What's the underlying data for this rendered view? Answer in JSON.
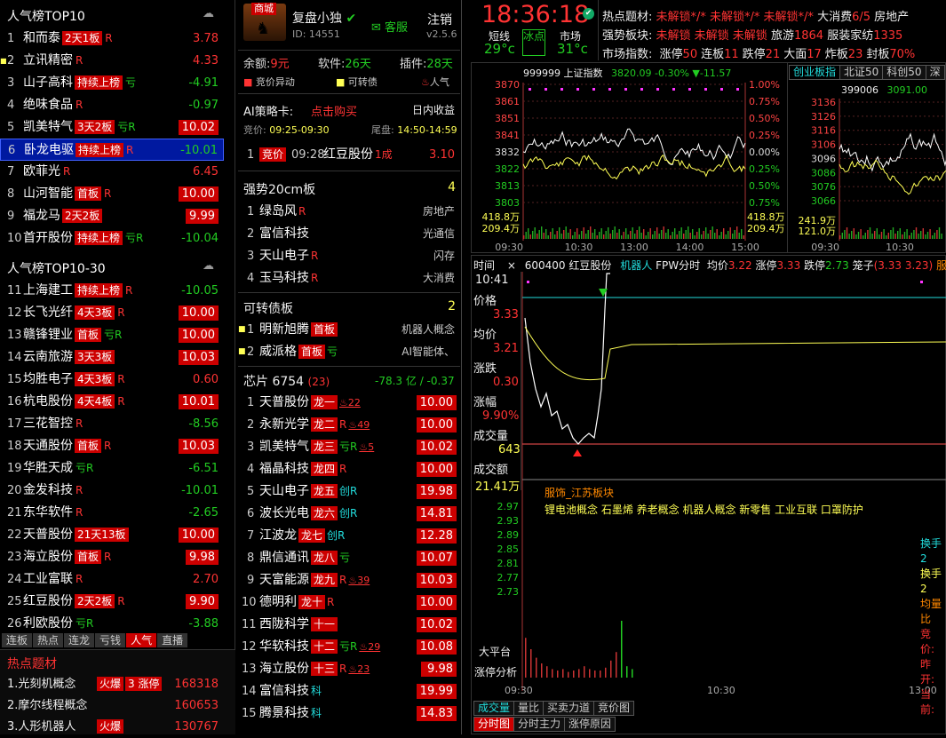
{
  "left": {
    "top10_title": "人气榜TOP10",
    "top10": [
      {
        "rank": "1",
        "name": "和而泰",
        "tag": "2天1板",
        "r": "R",
        "value": "3.78",
        "vc": "red"
      },
      {
        "rank": "2",
        "name": "立讯精密",
        "tag": "",
        "r": "R",
        "value": "4.33",
        "vc": "red",
        "mark": true
      },
      {
        "rank": "3",
        "name": "山子高科",
        "tag": "持续上榜",
        "r": "亏",
        "value": "-4.91",
        "vc": "grn"
      },
      {
        "rank": "4",
        "name": "绝味食品",
        "tag": "",
        "r": "R",
        "value": "-0.97",
        "vc": "grn"
      },
      {
        "rank": "5",
        "name": "凯美特气",
        "tag": "3天2板",
        "r": "亏R",
        "value": "10.02",
        "vc": "box"
      },
      {
        "rank": "6",
        "name": "卧龙电驱",
        "tag": "持续上榜",
        "r": "R",
        "value": "-10.01",
        "vc": "grn",
        "sel": true
      },
      {
        "rank": "7",
        "name": "欧菲光",
        "tag": "",
        "r": "R",
        "value": "6.45",
        "vc": "red"
      },
      {
        "rank": "8",
        "name": "山河智能",
        "tag": "首板",
        "r": "R",
        "value": "10.00",
        "vc": "box"
      },
      {
        "rank": "9",
        "name": "福龙马",
        "tag": "2天2板",
        "r": "",
        "value": "9.99",
        "vc": "box"
      },
      {
        "rank": "10",
        "name": "首开股份",
        "tag": "持续上榜",
        "r": "亏R",
        "value": "-10.04",
        "vc": "grn"
      }
    ],
    "top30_title": "人气榜TOP10-30",
    "top30": [
      {
        "rank": "11",
        "name": "上海建工",
        "tag": "持续上榜",
        "r": "R",
        "value": "-10.05",
        "vc": "grn"
      },
      {
        "rank": "12",
        "name": "长飞光纤",
        "tag": "4天3板",
        "r": "R",
        "value": "10.00",
        "vc": "box"
      },
      {
        "rank": "13",
        "name": "赣锋锂业",
        "tag": "首板",
        "r": "亏R",
        "value": "10.00",
        "vc": "box"
      },
      {
        "rank": "14",
        "name": "云南旅游",
        "tag": "3天3板",
        "r": "",
        "value": "10.03",
        "vc": "box"
      },
      {
        "rank": "15",
        "name": "均胜电子",
        "tag": "4天3板",
        "r": "R",
        "value": "0.60",
        "vc": "red"
      },
      {
        "rank": "16",
        "name": "杭电股份",
        "tag": "4天4板",
        "r": "R",
        "value": "10.01",
        "vc": "box"
      },
      {
        "rank": "17",
        "name": "三花智控",
        "tag": "",
        "r": "R",
        "value": "-8.56",
        "vc": "grn"
      },
      {
        "rank": "18",
        "name": "天通股份",
        "tag": "首板",
        "r": "R",
        "value": "10.03",
        "vc": "box"
      },
      {
        "rank": "19",
        "name": "华胜天成",
        "tag": "",
        "r": "亏R",
        "value": "-6.51",
        "vc": "grn"
      },
      {
        "rank": "20",
        "name": "金发科技",
        "tag": "",
        "r": "R",
        "value": "-10.01",
        "vc": "grn"
      },
      {
        "rank": "21",
        "name": "东华软件",
        "tag": "",
        "r": "R",
        "value": "-2.65",
        "vc": "grn"
      },
      {
        "rank": "22",
        "name": "天普股份",
        "tag": "21天13板",
        "r": "",
        "value": "10.00",
        "vc": "box"
      },
      {
        "rank": "23",
        "name": "海立股份",
        "tag": "首板",
        "r": "R",
        "value": "9.98",
        "vc": "box"
      },
      {
        "rank": "24",
        "name": "工业富联",
        "tag": "",
        "r": "R",
        "value": "2.70",
        "vc": "red"
      },
      {
        "rank": "25",
        "name": "红豆股份",
        "tag": "2天2板",
        "r": "R",
        "value": "9.90",
        "vc": "box"
      },
      {
        "rank": "26",
        "name": "利欧股份",
        "tag": "",
        "r": "亏R",
        "value": "-3.88",
        "vc": "grn"
      }
    ],
    "tabs": [
      "连板",
      "热点",
      "连龙",
      "亏钱",
      "人气",
      "直播"
    ],
    "active_tab": "人气",
    "hot_title": "热点题材",
    "hot": [
      {
        "name": "1.光刻机概念",
        "tags": [
          "火爆",
          "3 涨停"
        ],
        "value": "168318"
      },
      {
        "name": "2.摩尔线程概念",
        "tags": [],
        "value": "160653"
      },
      {
        "name": "3.人形机器人",
        "tags": [
          "火爆"
        ],
        "value": "130767"
      }
    ]
  },
  "mid": {
    "badge": "商城",
    "user": "复盘小独",
    "user_id": "ID: 14551",
    "service": "客服",
    "logout": "注销",
    "version": "v2.5.6",
    "balance": "余额:",
    "balance_val": "9元",
    "software": "软件:",
    "software_val": "26天",
    "plugin": "插件:",
    "plugin_val": "28天",
    "legend": [
      "竞价异动",
      "可转债",
      "人气"
    ],
    "ai_title": "AI策略卡:",
    "ai_buy": "点击购买",
    "ai_right": "日内收益",
    "auction_lbl": "竞价:",
    "auction_time": "09:25-09:30",
    "tail_lbl": "尾盘:",
    "tail_time": "14:50-14:59",
    "ai_row": {
      "rank": "1",
      "tag": "竞价",
      "time": "09:28",
      "name": "红豆股份",
      "board": "1成",
      "value": "3.10"
    },
    "s20_title": "强势20cm板",
    "s20_count": "4",
    "s20": [
      {
        "rank": "1",
        "name": "绿岛风",
        "r": "R",
        "sector": "房地产"
      },
      {
        "rank": "2",
        "name": "富信科技",
        "r": "",
        "sector": "光通信"
      },
      {
        "rank": "3",
        "name": "天山电子",
        "r": "R",
        "sector": "闪存"
      },
      {
        "rank": "4",
        "name": "玉马科技",
        "r": "R",
        "sector": "大消费"
      }
    ],
    "cb_title": "可转债板",
    "cb_count": "2",
    "cb": [
      {
        "rank": "1",
        "name": "明新旭腾",
        "tag": "首板",
        "r": "",
        "sector": "机器人概念"
      },
      {
        "rank": "2",
        "name": "威派格",
        "tag": "首板",
        "r": "亏",
        "sector": "AI智能体、"
      }
    ],
    "chip_title": "芯片",
    "chip_count": "6754",
    "chip_sub": "(23)",
    "chip_amt": "-78.3 亿",
    "chip_pct": "-0.37",
    "chips": [
      {
        "rank": "1",
        "name": "天普股份",
        "tag": "龙一",
        "r": "",
        "heat": "♨22",
        "value": "10.00"
      },
      {
        "rank": "2",
        "name": "永新光学",
        "tag": "龙二",
        "r": "R",
        "heat": "♨49",
        "value": "10.00"
      },
      {
        "rank": "3",
        "name": "凯美特气",
        "tag": "龙三",
        "r": "亏R",
        "heat": "♨5",
        "value": "10.02"
      },
      {
        "rank": "4",
        "name": "福晶科技",
        "tag": "龙四",
        "r": "R",
        "heat": "",
        "value": "10.00"
      },
      {
        "rank": "5",
        "name": "天山电子",
        "tag": "龙五",
        "r": "创R",
        "heat": "",
        "value": "19.98"
      },
      {
        "rank": "6",
        "name": "波长光电",
        "tag": "龙六",
        "r": "创R",
        "heat": "",
        "value": "14.81"
      },
      {
        "rank": "7",
        "name": "江波龙",
        "tag": "龙七",
        "r": "创R",
        "heat": "",
        "value": "12.28"
      },
      {
        "rank": "8",
        "name": "鼎信通讯",
        "tag": "龙八",
        "r": "亏",
        "heat": "",
        "value": "10.07"
      },
      {
        "rank": "9",
        "name": "天富能源",
        "tag": "龙九",
        "r": "R",
        "heat": "♨39",
        "value": "10.03"
      },
      {
        "rank": "10",
        "name": "德明利",
        "tag": "龙十",
        "r": "R",
        "heat": "",
        "value": "10.00"
      },
      {
        "rank": "11",
        "name": "西陇科学",
        "tag": "十一",
        "r": "",
        "heat": "",
        "value": "10.02"
      },
      {
        "rank": "12",
        "name": "华软科技",
        "tag": "十二",
        "r": "亏R",
        "heat": "♨29",
        "value": "10.08"
      },
      {
        "rank": "13",
        "name": "海立股份",
        "tag": "十三",
        "r": "R",
        "heat": "♨23",
        "value": "9.98"
      },
      {
        "rank": "14",
        "name": "富信科技",
        "tag": "",
        "r": "科",
        "heat": "",
        "value": "19.99"
      },
      {
        "rank": "15",
        "name": "腾景科技",
        "tag": "",
        "r": "科",
        "heat": "",
        "value": "14.83"
      }
    ]
  },
  "top": {
    "clock": "18:36:18",
    "short": "短线",
    "short_val": "29°c",
    "ice": "冰点",
    "market": "市场",
    "market_val": "31°c",
    "hot_label": "热点题材:",
    "hot_items": "未解锁*/* 未解锁*/* 未解锁*/*",
    "hot_tail": "大消费",
    "hot_tail_v": "6/5",
    "hot_tail2": "房地产",
    "strong_label": "强势板块:",
    "strong_items": "未解锁 未解锁 未解锁",
    "strong_tail": "旅游",
    "strong_tail_v": "1864",
    "strong_tail2": "服装家纺",
    "strong_tail2_v": "1335",
    "idx_label": "市场指数:",
    "idx": [
      {
        "k": "涨停",
        "v": "50"
      },
      {
        "k": "连板",
        "v": "11"
      },
      {
        "k": "跌停",
        "v": "21"
      },
      {
        "k": "大面",
        "v": "17"
      },
      {
        "k": "炸板",
        "v": "23"
      },
      {
        "k": "封板",
        "v": "70%"
      }
    ]
  },
  "index_chart": {
    "code": "999999",
    "name": "上证指数",
    "price": "3820.09",
    "pct": "-0.30%",
    "chg": "▼-11.57",
    "yticks": [
      "3870",
      "3861",
      "3851",
      "3841",
      "3832",
      "3822",
      "3813",
      "3803"
    ],
    "pticks": [
      "1.00%",
      "0.75%",
      "0.50%",
      "0.25%",
      "0.00%",
      "0.25%",
      "0.50%",
      "0.75%"
    ],
    "vol1": "418.8万",
    "vol2": "209.4万",
    "times": [
      "09:30",
      "10:30",
      "13:00",
      "14:00",
      "15:00"
    ]
  },
  "index2": {
    "tabs": [
      "创业板指",
      "北证50",
      "科创50",
      "深"
    ],
    "code": "399006",
    "price": "3091.00",
    "yticks": [
      "3136",
      "3126",
      "3116",
      "3106",
      "3096",
      "3086",
      "3076",
      "3066"
    ],
    "vol1": "241.9万",
    "vol2": "121.0万",
    "times": [
      "09:30",
      "10:30"
    ]
  },
  "stock": {
    "time_lbl": "时间",
    "close": "×",
    "code": "600400",
    "name": "红豆股份",
    "concept": "机器人",
    "mode": "FPW分时",
    "avg_lbl": "均价",
    "avg": "3.22",
    "up_lbl": "涨停",
    "up": "3.33",
    "down_lbl": "跌停",
    "down": "2.73",
    "cage_lbl": "笼子",
    "cage": "(3.33 3.23)",
    "industry": "服饰",
    "time_val": "10:41",
    "price_lbl": "价格",
    "price_val": "3.33",
    "avg2_lbl": "均价",
    "avg2_val": "3.21",
    "chg_lbl": "涨跌",
    "chg_val": "0.30",
    "amp_lbl": "涨幅",
    "amp_val": "9.90%",
    "vol_lbl": "成交量",
    "vol_val": "643",
    "amt_lbl": "成交额",
    "amt_val": "21.41万",
    "yticks": [
      "2.97",
      "2.93",
      "2.89",
      "2.85",
      "2.81",
      "2.77",
      "2.73"
    ],
    "sector_line": "服饰_江苏板块",
    "concepts": "锂电池概念 石墨烯 养老概念 机器人概念 新零售 工业互联 口罩防护",
    "side": [
      "换手2",
      "换手2",
      "均量比",
      "竞价:",
      "昨开:",
      "当前:"
    ],
    "side_colors": [
      "#2dd",
      "#ff5",
      "#f80",
      "#f33",
      "#f33",
      "#f33"
    ],
    "platform": "大平台",
    "limit_analysis": "涨停分析",
    "times": [
      "09:30",
      "10:30",
      "13:00"
    ],
    "bottom_tabs": [
      "成交量",
      "量比",
      "买卖力道",
      "竞价图"
    ],
    "bottom_tabs2": [
      "分时图",
      "分时主力",
      "涨停原因"
    ]
  }
}
